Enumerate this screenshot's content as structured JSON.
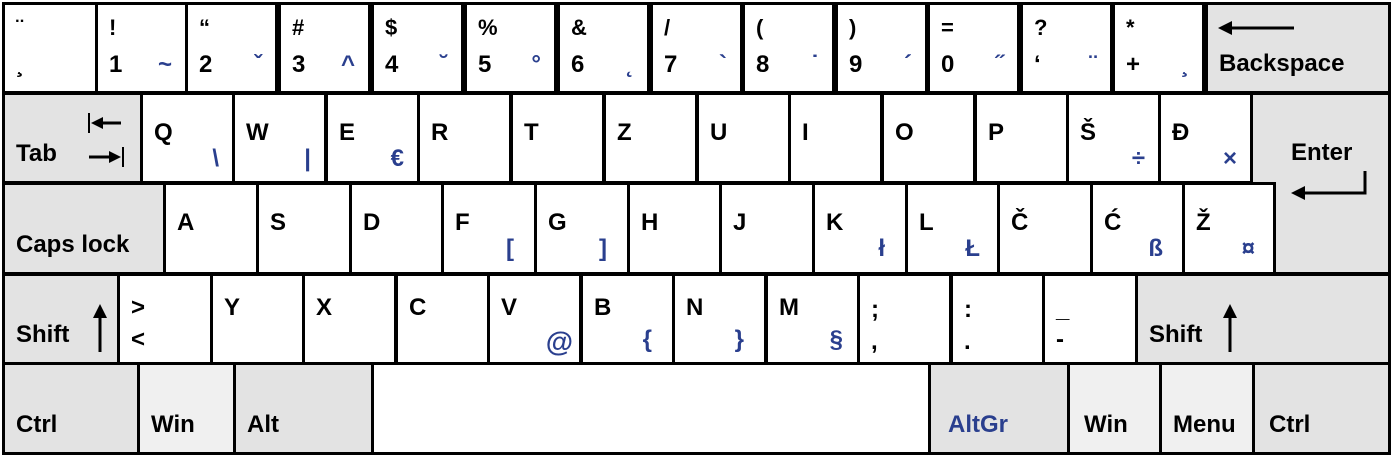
{
  "colors": {
    "altgr_text": "#2a3f8e",
    "modifier_bg": "#e3e3e3",
    "key_bg": "#ffffff",
    "border": "#000000"
  },
  "row1": [
    {
      "shift": "¨",
      "base": "¸",
      "altgr": ""
    },
    {
      "shift": "!",
      "base": "1",
      "altgr": "~"
    },
    {
      "shift": "“",
      "base": "2",
      "altgr": "ˇ"
    },
    {
      "shift": "#",
      "base": "3",
      "altgr": "^"
    },
    {
      "shift": "$",
      "base": "4",
      "altgr": "˘"
    },
    {
      "shift": "%",
      "base": "5",
      "altgr": "°"
    },
    {
      "shift": "&",
      "base": "6",
      "altgr": "˛"
    },
    {
      "shift": "/",
      "base": "7",
      "altgr": "`"
    },
    {
      "shift": "(",
      "base": "8",
      "altgr": "˙"
    },
    {
      "shift": ")",
      "base": "9",
      "altgr": "´"
    },
    {
      "shift": "=",
      "base": "0",
      "altgr": "˝"
    },
    {
      "shift": "?",
      "base": "‘",
      "altgr": "¨"
    },
    {
      "shift": "*",
      "base": "+",
      "altgr": "¸"
    }
  ],
  "backspace": {
    "label": "Backspace",
    "icon": "arrow-left-icon"
  },
  "tab": {
    "label": "Tab",
    "icon": "tab-arrows-icon"
  },
  "row2": [
    {
      "base": "Q",
      "altgr": "\\"
    },
    {
      "base": "W",
      "altgr": "|"
    },
    {
      "base": "E",
      "altgr": "€"
    },
    {
      "base": "R",
      "altgr": ""
    },
    {
      "base": "T",
      "altgr": ""
    },
    {
      "base": "Z",
      "altgr": ""
    },
    {
      "base": "U",
      "altgr": ""
    },
    {
      "base": "I",
      "altgr": ""
    },
    {
      "base": "O",
      "altgr": ""
    },
    {
      "base": "P",
      "altgr": ""
    },
    {
      "base": "Š",
      "altgr": "÷"
    },
    {
      "base": "Đ",
      "altgr": "×"
    }
  ],
  "enter": {
    "label": "Enter",
    "icon": "enter-arrow-icon"
  },
  "capslock": {
    "label": "Caps lock"
  },
  "row3": [
    {
      "base": "A",
      "altgr": ""
    },
    {
      "base": "S",
      "altgr": ""
    },
    {
      "base": "D",
      "altgr": ""
    },
    {
      "base": "F",
      "altgr": "["
    },
    {
      "base": "G",
      "altgr": "]"
    },
    {
      "base": "H",
      "altgr": ""
    },
    {
      "base": "J",
      "altgr": ""
    },
    {
      "base": "K",
      "altgr": "ł"
    },
    {
      "base": "L",
      "altgr": "Ł"
    },
    {
      "base": "Č",
      "altgr": ""
    },
    {
      "base": "Ć",
      "altgr": "ß"
    },
    {
      "base": "Ž",
      "altgr": "¤"
    }
  ],
  "lshift": {
    "label": "Shift",
    "icon": "arrow-up-icon"
  },
  "row4": [
    {
      "shift": ">",
      "base": "<",
      "altgr": ""
    },
    {
      "shift": "Y",
      "base": "",
      "altgr": ""
    },
    {
      "shift": "X",
      "base": "",
      "altgr": ""
    },
    {
      "shift": "C",
      "base": "",
      "altgr": ""
    },
    {
      "shift": "V",
      "base": "",
      "altgr": "@"
    },
    {
      "shift": "B",
      "base": "",
      "altgr": "{"
    },
    {
      "shift": "N",
      "base": "",
      "altgr": "}"
    },
    {
      "shift": "M",
      "base": "",
      "altgr": "§"
    },
    {
      "shift": ";",
      "base": ",",
      "altgr": ""
    },
    {
      "shift": ":",
      "base": ".",
      "altgr": ""
    },
    {
      "shift": "_",
      "base": "-",
      "altgr": ""
    }
  ],
  "rshift": {
    "label": "Shift",
    "icon": "arrow-up-icon"
  },
  "row5": {
    "lctrl": "Ctrl",
    "lwin": "Win",
    "alt": "Alt",
    "space": "",
    "altgr": "AltGr",
    "rwin": "Win",
    "menu": "Menu",
    "rctrl": "Ctrl"
  }
}
